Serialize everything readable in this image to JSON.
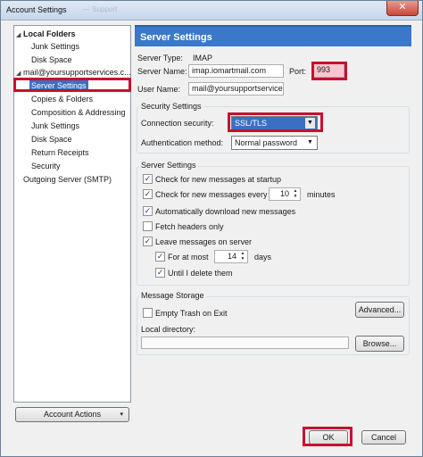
{
  "window": {
    "title": "Account Settings",
    "background_tab_text": "— Support",
    "close_glyph": "✕"
  },
  "tree": {
    "items": [
      {
        "label": "Local Folders",
        "twisty": "◢",
        "bold": true
      },
      {
        "label": "Junk Settings"
      },
      {
        "label": "Disk Space"
      },
      {
        "label": "mail@yoursupportservices.c...",
        "twisty": "◢"
      },
      {
        "label": "Server Settings",
        "selected": true
      },
      {
        "label": "Copies & Folders"
      },
      {
        "label": "Composition & Addressing"
      },
      {
        "label": "Junk Settings"
      },
      {
        "label": "Disk Space"
      },
      {
        "label": "Return Receipts"
      },
      {
        "label": "Security"
      },
      {
        "label": "Outgoing Server (SMTP)"
      }
    ]
  },
  "account_actions": {
    "label": "Account Actions",
    "caret": "▾"
  },
  "server_settings": {
    "header": "Server Settings",
    "server_type_label": "Server Type:",
    "server_type_value": "IMAP",
    "server_name_label": "Server Name:",
    "server_name_value": "imap.iomartmail.com",
    "port_label": "Port:",
    "port_value": "993",
    "user_name_label": "User Name:",
    "user_name_value": "mail@yoursupportservices",
    "security_settings_title": "Security Settings",
    "connection_security_label": "Connection security:",
    "connection_security_value": "SSL/TLS",
    "auth_method_label": "Authentication method:",
    "auth_method_value": "Normal password",
    "dropdown_arrow": "▼",
    "server_settings_title": "Server Settings",
    "check_startup_label": "Check for new messages at startup",
    "check_every_label": "Check for new messages every",
    "check_every_value": "10",
    "minutes_label": "minutes",
    "auto_download_label": "Automatically download new messages",
    "fetch_headers_label": "Fetch headers only",
    "leave_messages_label": "Leave messages on server",
    "for_at_most_label": "For at most",
    "for_at_most_value": "14",
    "days_label": "days",
    "until_delete_label": "Until I delete them",
    "message_storage_title": "Message Storage",
    "empty_trash_label": "Empty Trash on Exit",
    "advanced_label": "Advanced...",
    "local_directory_label": "Local directory:",
    "local_directory_value": "",
    "browse_label": "Browse...",
    "check_glyph": "✓",
    "spin_up": "▲",
    "spin_down": "▼"
  },
  "checkboxes": {
    "check_startup": true,
    "check_every": true,
    "auto_download": true,
    "fetch_headers": false,
    "leave_messages": true,
    "for_at_most": true,
    "until_delete": true,
    "empty_trash": false
  },
  "footer": {
    "ok_label": "OK",
    "cancel_label": "Cancel"
  },
  "colors": {
    "highlight_red": "#c8102e",
    "header_blue": "#3a79c9",
    "selection_blue": "#3a6fc4",
    "port_pink": "#f9c6cf"
  }
}
